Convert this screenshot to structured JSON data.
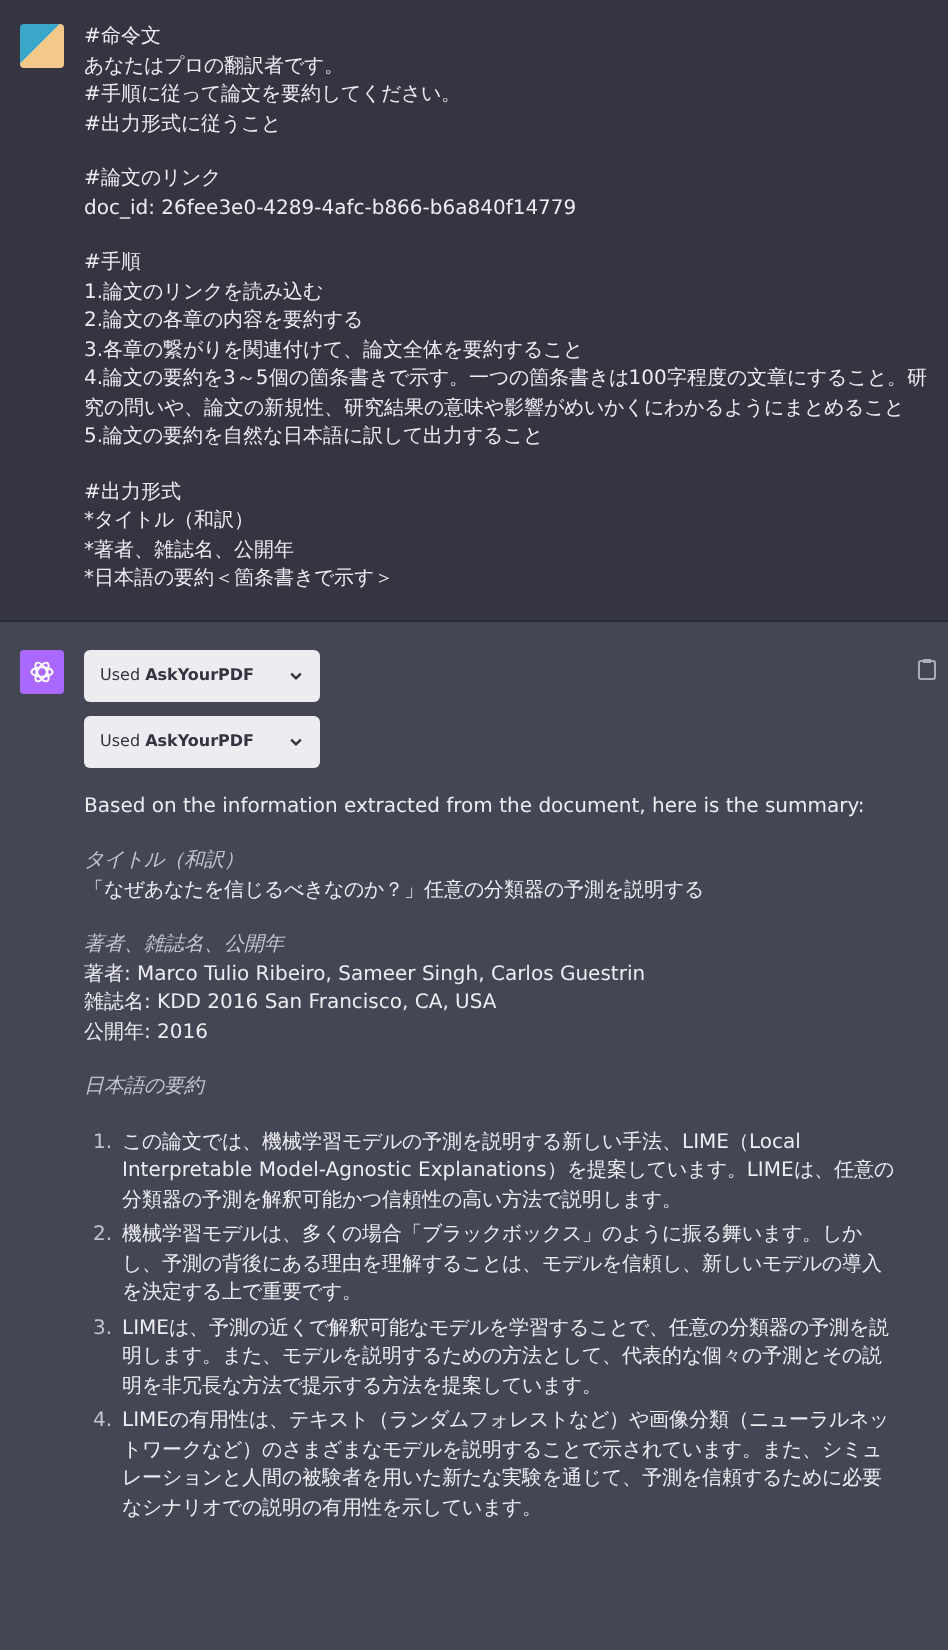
{
  "messages": [
    {
      "kind": "user",
      "paragraphs": [
        [
          "#命令文",
          "あなたはプロの翻訳者です。",
          "#手順に従って論文を要約してください。",
          "#出力形式に従うこと"
        ],
        [
          "#論文のリンク",
          "doc_id: 26fee3e0-4289-4afc-b866-b6a840f14779"
        ],
        [
          "#手順",
          "1.論文のリンクを読み込む",
          "2.論文の各章の内容を要約する",
          "3.各章の繋がりを関連付けて、論文全体を要約すること",
          "4.論文の要約を3～5個の箇条書きで示す。一つの箇条書きは100字程度の文章にすること。研究の問いや、論文の新規性、研究結果の意味や影響がめいかくにわかるようにまとめること",
          "5.論文の要約を自然な日本語に訳して出力すること"
        ],
        [
          "#出力形式",
          "*タイトル（和訳）",
          "*著者、雑誌名、公開年",
          "*日本語の要約＜箇条書きで示す＞"
        ]
      ]
    },
    {
      "kind": "assistant",
      "plugins": [
        "Used **AskYourPDF**",
        "Used **AskYourPDF**"
      ],
      "blocks": [
        {
          "kind": "text",
          "lines": [
            "Based on the information extracted from the document, here is the summary:"
          ]
        },
        {
          "kind": "section",
          "heading": "タイトル（和訳）",
          "lines": [
            "「なぜあなたを信じるべきなのか？」任意の分類器の予測を説明する"
          ]
        },
        {
          "kind": "section",
          "heading": "著者、雑誌名、公開年",
          "lines": [
            "著者: Marco Tulio Ribeiro, Sameer Singh, Carlos Guestrin",
            "雑誌名: KDD 2016 San Francisco, CA, USA",
            "公開年: 2016"
          ]
        },
        {
          "kind": "section",
          "heading": "日本語の要約"
        },
        {
          "kind": "list",
          "items": [
            {
              "number": "1.",
              "text": "この論文では、機械学習モデルの予測を説明する新しい手法、LIME（Local Interpretable Model-Agnostic Explanations）を提案しています。LIMEは、任意の分類器の予測を解釈可能かつ信頼性の高い方法で説明します。"
            },
            {
              "number": "2.",
              "text": "機械学習モデルは、多くの場合「ブラックボックス」のように振る舞います。しかし、予測の背後にある理由を理解することは、モデルを信頼し、新しいモデルの導入を決定する上で重要です。"
            },
            {
              "number": "3.",
              "text": "LIMEは、予測の近くで解釈可能なモデルを学習することで、任意の分類器の予測を説明します。また、モデルを説明するための方法として、代表的な個々の予測とその説明を非冗長な方法で提示する方法を提案しています。"
            },
            {
              "number": "4.",
              "text": "LIMEの有用性は、テキスト（ランダムフォレストなど）や画像分類（ニューラルネットワークなど）のさまざまなモデルを説明することで示されています。また、シミュレーションと人間の被験者を用いた新たな実験を通じて、予測を信頼するために必要なシナリオでの説明の有用性を示しています。"
            }
          ]
        }
      ]
    }
  ]
}
